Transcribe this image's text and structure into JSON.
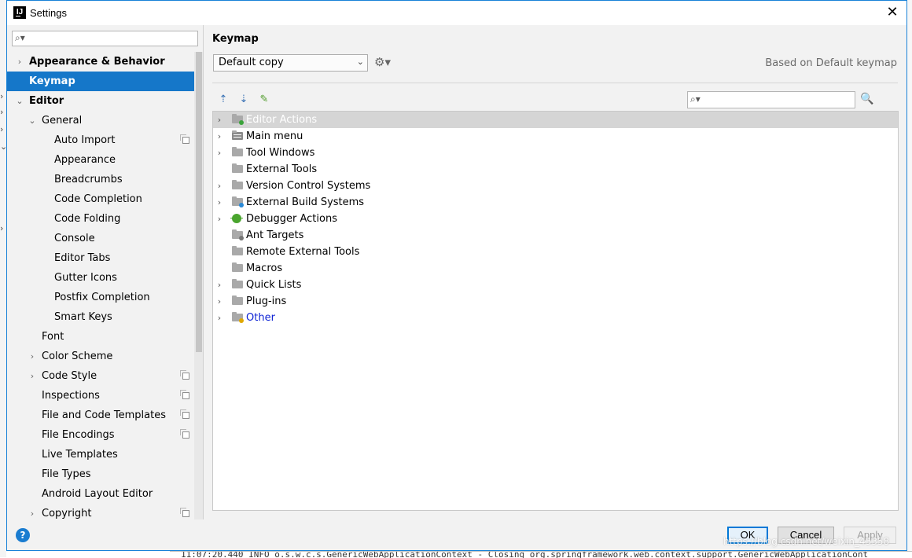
{
  "window": {
    "title": "Settings",
    "app_icon_text": "IJ",
    "close_glyph": "✕"
  },
  "search": {
    "placeholder": "",
    "value": ""
  },
  "sidebar": {
    "items": [
      {
        "label": "Appearance & Behavior",
        "level": 0,
        "arrow": "›",
        "bold": true
      },
      {
        "label": "Keymap",
        "level": 0,
        "arrow": "",
        "bold": true,
        "selected": true
      },
      {
        "label": "Editor",
        "level": 0,
        "arrow": "⌄",
        "bold": true
      },
      {
        "label": "General",
        "level": 1,
        "arrow": "⌄"
      },
      {
        "label": "Auto Import",
        "level": 2,
        "arrow": "",
        "copy": true
      },
      {
        "label": "Appearance",
        "level": 2,
        "arrow": ""
      },
      {
        "label": "Breadcrumbs",
        "level": 2,
        "arrow": ""
      },
      {
        "label": "Code Completion",
        "level": 2,
        "arrow": ""
      },
      {
        "label": "Code Folding",
        "level": 2,
        "arrow": ""
      },
      {
        "label": "Console",
        "level": 2,
        "arrow": ""
      },
      {
        "label": "Editor Tabs",
        "level": 2,
        "arrow": ""
      },
      {
        "label": "Gutter Icons",
        "level": 2,
        "arrow": ""
      },
      {
        "label": "Postfix Completion",
        "level": 2,
        "arrow": ""
      },
      {
        "label": "Smart Keys",
        "level": 2,
        "arrow": ""
      },
      {
        "label": "Font",
        "level": 1,
        "arrow": ""
      },
      {
        "label": "Color Scheme",
        "level": 1,
        "arrow": "›"
      },
      {
        "label": "Code Style",
        "level": 1,
        "arrow": "›",
        "copy": true
      },
      {
        "label": "Inspections",
        "level": 1,
        "arrow": "",
        "copy": true
      },
      {
        "label": "File and Code Templates",
        "level": 1,
        "arrow": "",
        "copy": true
      },
      {
        "label": "File Encodings",
        "level": 1,
        "arrow": "",
        "copy": true
      },
      {
        "label": "Live Templates",
        "level": 1,
        "arrow": ""
      },
      {
        "label": "File Types",
        "level": 1,
        "arrow": ""
      },
      {
        "label": "Android Layout Editor",
        "level": 1,
        "arrow": ""
      },
      {
        "label": "Copyright",
        "level": 1,
        "arrow": "›",
        "copy": true
      }
    ]
  },
  "keymap": {
    "section_title": "Keymap",
    "selected_keymap": "Default copy",
    "dropdown_glyph": "⌄",
    "gear_glyph": "⚙▾",
    "based_on": "Based on Default keymap",
    "toolbar": {
      "expand_glyph": "⇡",
      "collapse_glyph": "⇣",
      "edit_glyph": "✎"
    },
    "action_search": {
      "placeholder": "",
      "value": ""
    },
    "shortcut_search_glyph": "🔍",
    "actions": [
      {
        "label": "Editor Actions",
        "arrow": "›",
        "icon": "folder",
        "selected": true,
        "badge": "#3aa33a"
      },
      {
        "label": "Main menu",
        "arrow": "›",
        "icon": "menu"
      },
      {
        "label": "Tool Windows",
        "arrow": "›",
        "icon": "folder"
      },
      {
        "label": "External Tools",
        "arrow": "",
        "icon": "folder"
      },
      {
        "label": "Version Control Systems",
        "arrow": "›",
        "icon": "folder"
      },
      {
        "label": "External Build Systems",
        "arrow": "›",
        "icon": "folder",
        "badge": "#2a8ad8"
      },
      {
        "label": "Debugger Actions",
        "arrow": "›",
        "icon": "bug"
      },
      {
        "label": "Ant Targets",
        "arrow": "",
        "icon": "folder",
        "badge": "#777777"
      },
      {
        "label": "Remote External Tools",
        "arrow": "",
        "icon": "folder"
      },
      {
        "label": "Macros",
        "arrow": "",
        "icon": "folder"
      },
      {
        "label": "Quick Lists",
        "arrow": "›",
        "icon": "folder"
      },
      {
        "label": "Plug-ins",
        "arrow": "›",
        "icon": "folder"
      },
      {
        "label": "Other",
        "arrow": "›",
        "icon": "folder",
        "link": true,
        "badge": "#e0a800"
      }
    ]
  },
  "buttons": {
    "help": "?",
    "ok": "OK",
    "cancel": "Cancel",
    "apply": "Apply"
  },
  "background": {
    "log_line": "11:07:20.440 INFO  o.s.w.c.s.GenericWebApplicationContext - Closing org.springframework.web.context.support.GenericWebApplicationCont",
    "watermark": "https://blog.csdn.net/weixin_43358"
  },
  "colors": {
    "accent": "#1577c9",
    "selection_bg": "#d5d5d5",
    "link": "#0d22d4"
  }
}
